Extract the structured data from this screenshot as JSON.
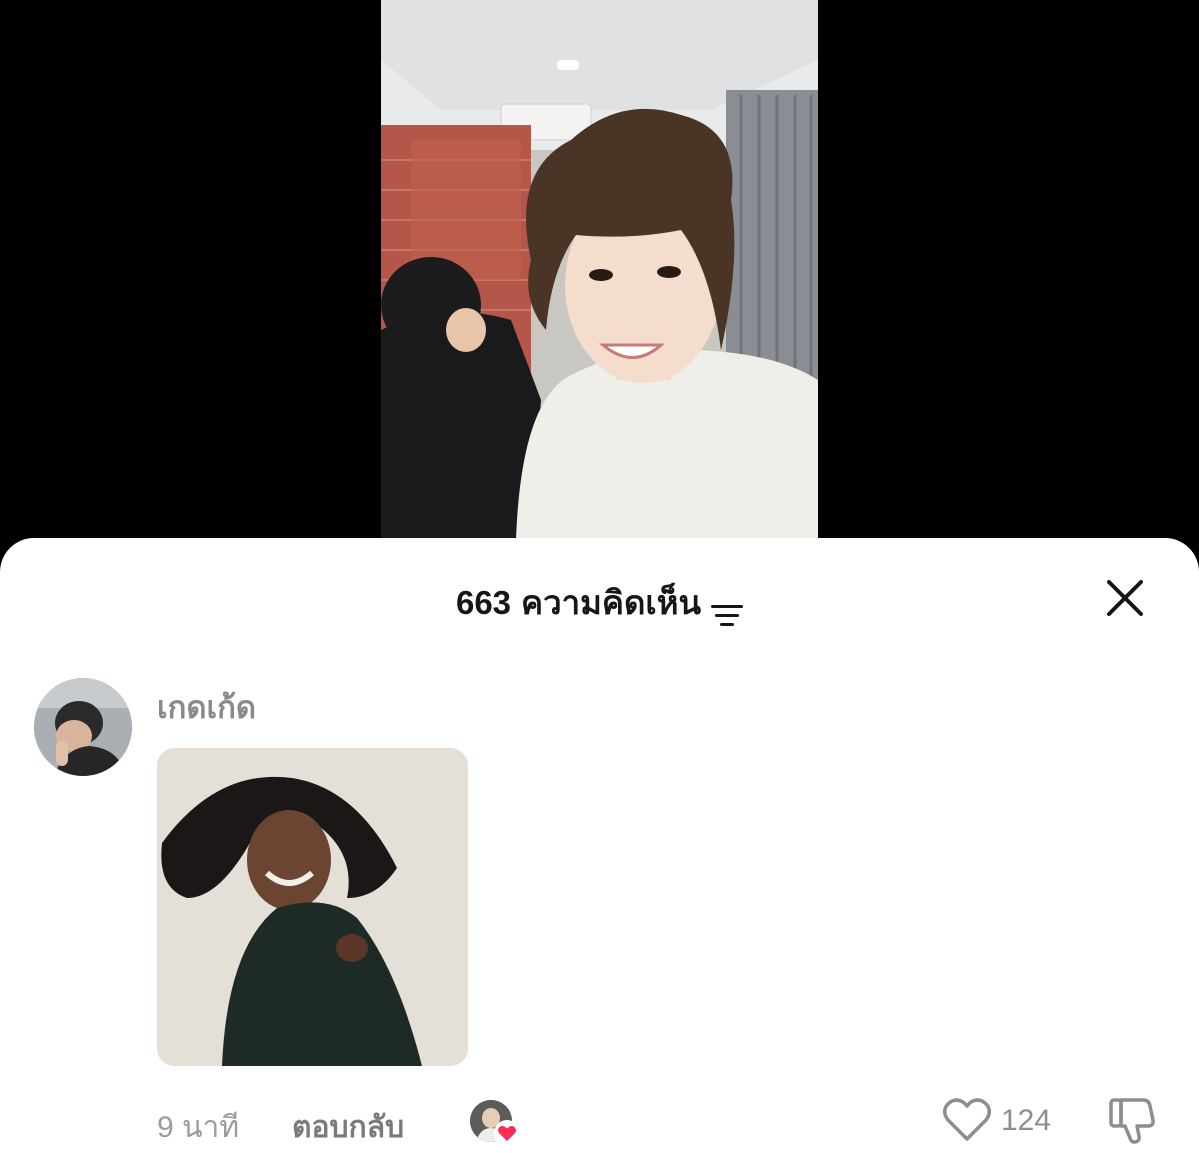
{
  "sheet": {
    "comment_count": "663",
    "title_suffix": "ความคิดเห็น"
  },
  "comment": {
    "username": "เกดเก้ด",
    "time": "9 นาที",
    "reply_label": "ตอบกลับ",
    "like_count": "124"
  },
  "icons": {
    "sort": "sort-lines-icon",
    "close": "close-x-icon",
    "like": "heart-outline-icon",
    "dislike": "thumbs-down-icon",
    "creator_liked": "heart-filled-icon"
  },
  "colors": {
    "sheet_bg": "#ffffff",
    "heart_red": "#fe2c55",
    "muted_text": "#8a8a8a"
  }
}
